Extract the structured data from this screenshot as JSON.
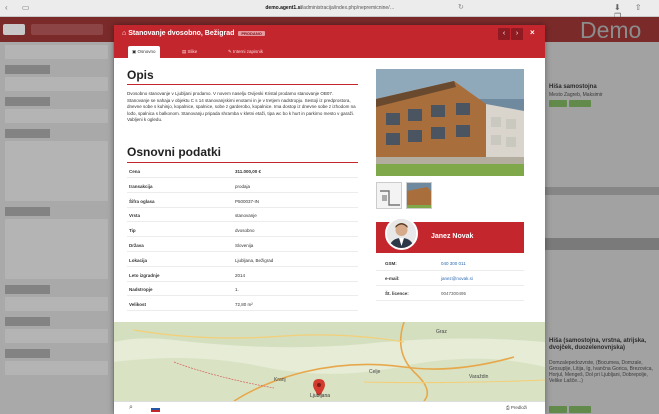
{
  "browser": {
    "url_domain": "demo.agent1.si",
    "url_rest": "/administracija/index.php/nepremicnine/…",
    "icons": [
      "back-icon",
      "sidebar-icon",
      "reload-icon",
      "download-icon",
      "share-icon",
      "tabs-icon"
    ]
  },
  "app": {
    "brand_text": "Demo"
  },
  "modal": {
    "title": "Stanovanje dvosobno, Bežigrad",
    "status_badge": "PRODANO",
    "tabs": [
      {
        "label": "Osnovno",
        "active": true
      },
      {
        "label": "Slike",
        "active": false
      },
      {
        "label": "Interni zapisnik",
        "active": false
      }
    ],
    "prev_symbol": "‹",
    "next_symbol": "›",
    "close_symbol": "×",
    "opis_heading": "Opis",
    "description": "Dvosobno stanovanje v Ljubljani prodamo. V novem naselju Ovijeski Kristal prodamo stanovanje OB07. Stanovanje se nahaja v objektu C s 14 stanovanjskimi enotami in je v tretjem nadstropju. Sestoji iz predprostora, dnevne sobe s kuhinjo, kopalnice, spalnice, sobe z garderobo, kopalnice. Ima dostop iz dnevne sobe z izhodom na lođo, spalnica s balkonom. Stanovanju pripada shramba v kletni etaži, tipa wc bo k hurt in parkirno mesto v garaži. Vabljeni k ogledu.",
    "osnovni_heading": "Osnovni podatki",
    "details": [
      {
        "label": "Cena",
        "value": "311.000,00 €",
        "bold": true
      },
      {
        "label": "transakcija",
        "value": "prodaja"
      },
      {
        "label": "Šifra oglasa",
        "value": "P500037-IN"
      },
      {
        "label": "Vrsta",
        "value": "stanovanje"
      },
      {
        "label": "Tip",
        "value": "dvosobno"
      },
      {
        "label": "Država",
        "value": "Slovenija"
      },
      {
        "label": "Lokacija",
        "value": "Ljubljana, Bežigrad"
      },
      {
        "label": "Leto izgradnje",
        "value": "2014"
      },
      {
        "label": "Nadstropje",
        "value": "1."
      },
      {
        "label": "Velikost",
        "value": "72,80 m²"
      }
    ],
    "agent": {
      "name": "Janez Novak",
      "contacts": [
        {
          "label": "GSM:",
          "value": "040 300 011",
          "link": true
        },
        {
          "label": "e-mail:",
          "value": "janez@novak.si",
          "link": true
        },
        {
          "label": "Št. licence:",
          "value": "0047300495",
          "link": false
        }
      ]
    },
    "map": {
      "places": [
        "Ljubljana",
        "Graz",
        "Zagreb",
        "Varaždin",
        "Celje",
        "Kranj",
        "Maribor",
        "Jesenice",
        "Novo Mesto"
      ],
      "bottom_left_icon": "search-icon",
      "print_label": "Predloži"
    }
  },
  "left_panel": {
    "labels": [
      "Tip:",
      "Velikost",
      "Nasalje",
      "Opisovanje",
      "Oznaka",
      "Datum vnosa",
      "Zadnja sprememba",
      "Datum prodaje",
      "Opis"
    ]
  },
  "right_panel": {
    "card1_title": "Hiša samostojna",
    "card1_location": "Mesto Zagreb, Maksimir",
    "card2_title": "Hiša (samostojna, vrstna, atrijska, dvojček, duozelenovnjska)",
    "card2_location": "Domzalepedozvrste, (Bocumea, Domzale, Grosuplje, Litija, Ig, Ivančna Gorica, Brezovica, Horjul, Mengeš, Dol pri Ljubljani, Dobrepolje, Velike Lašče...)"
  }
}
